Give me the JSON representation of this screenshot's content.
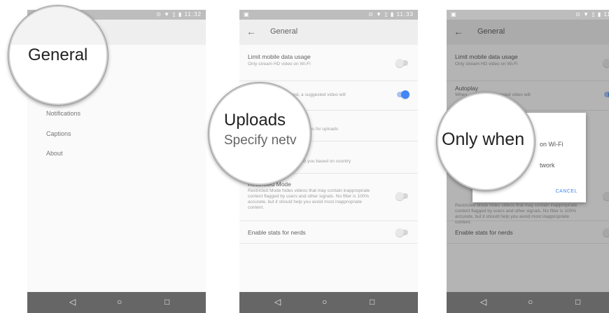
{
  "status_bar": {
    "time_a": "11:32",
    "time_b": "11:33",
    "icons": "⊙ ▼ ▯ ▮"
  },
  "screen1": {
    "zoom_label": "General",
    "menu_items": [
      "Notifications",
      "Captions",
      "About"
    ]
  },
  "screen2": {
    "title": "General",
    "settings": [
      {
        "title": "Limit mobile data usage",
        "sub": "Only stream HD video on Wi-Fi"
      },
      {
        "title": "",
        "sub": "stred, a suggested video will"
      },
      {
        "title": "",
        "sub": "ces for uploads"
      },
      {
        "title": "",
        "sub": "own to you based on country"
      },
      {
        "title": "Restricted Mode",
        "sub": "Restricted Mode hides videos that may contain inappropriate content flagged by users and other signals. No filter is 100% accurate, but it should help you avoid most inappropriate content."
      },
      {
        "title": "Enable stats for nerds",
        "sub": ""
      }
    ],
    "zoom_title": "Uploads",
    "zoom_sub": "Specify netv"
  },
  "screen3": {
    "title": "General",
    "settings": [
      {
        "title": "Limit mobile data usage",
        "sub": "Only stream HD video on Wi-Fi"
      },
      {
        "title": "Autoplay",
        "sub": "When ... stred, a suggested video will"
      },
      {
        "title": "Enable stats for nerds",
        "sub": ""
      }
    ],
    "restricted_text": "Restricted Mode hides videos that may contain inappropriate content flagged by users and other signals. No filter is 100% accurate, but it should help you avoid most inappropriate content.",
    "dialog": {
      "option1": "on Wi-Fi",
      "option2": "twork",
      "cancel": "CANCEL"
    },
    "zoom_text": "Only when"
  },
  "navbar": {
    "back_icon": "◁",
    "home_icon": "○",
    "recents_icon": "□"
  },
  "colors": {
    "accent": "#4285f4",
    "navbar": "#666666",
    "appbar": "#eeeeee"
  }
}
